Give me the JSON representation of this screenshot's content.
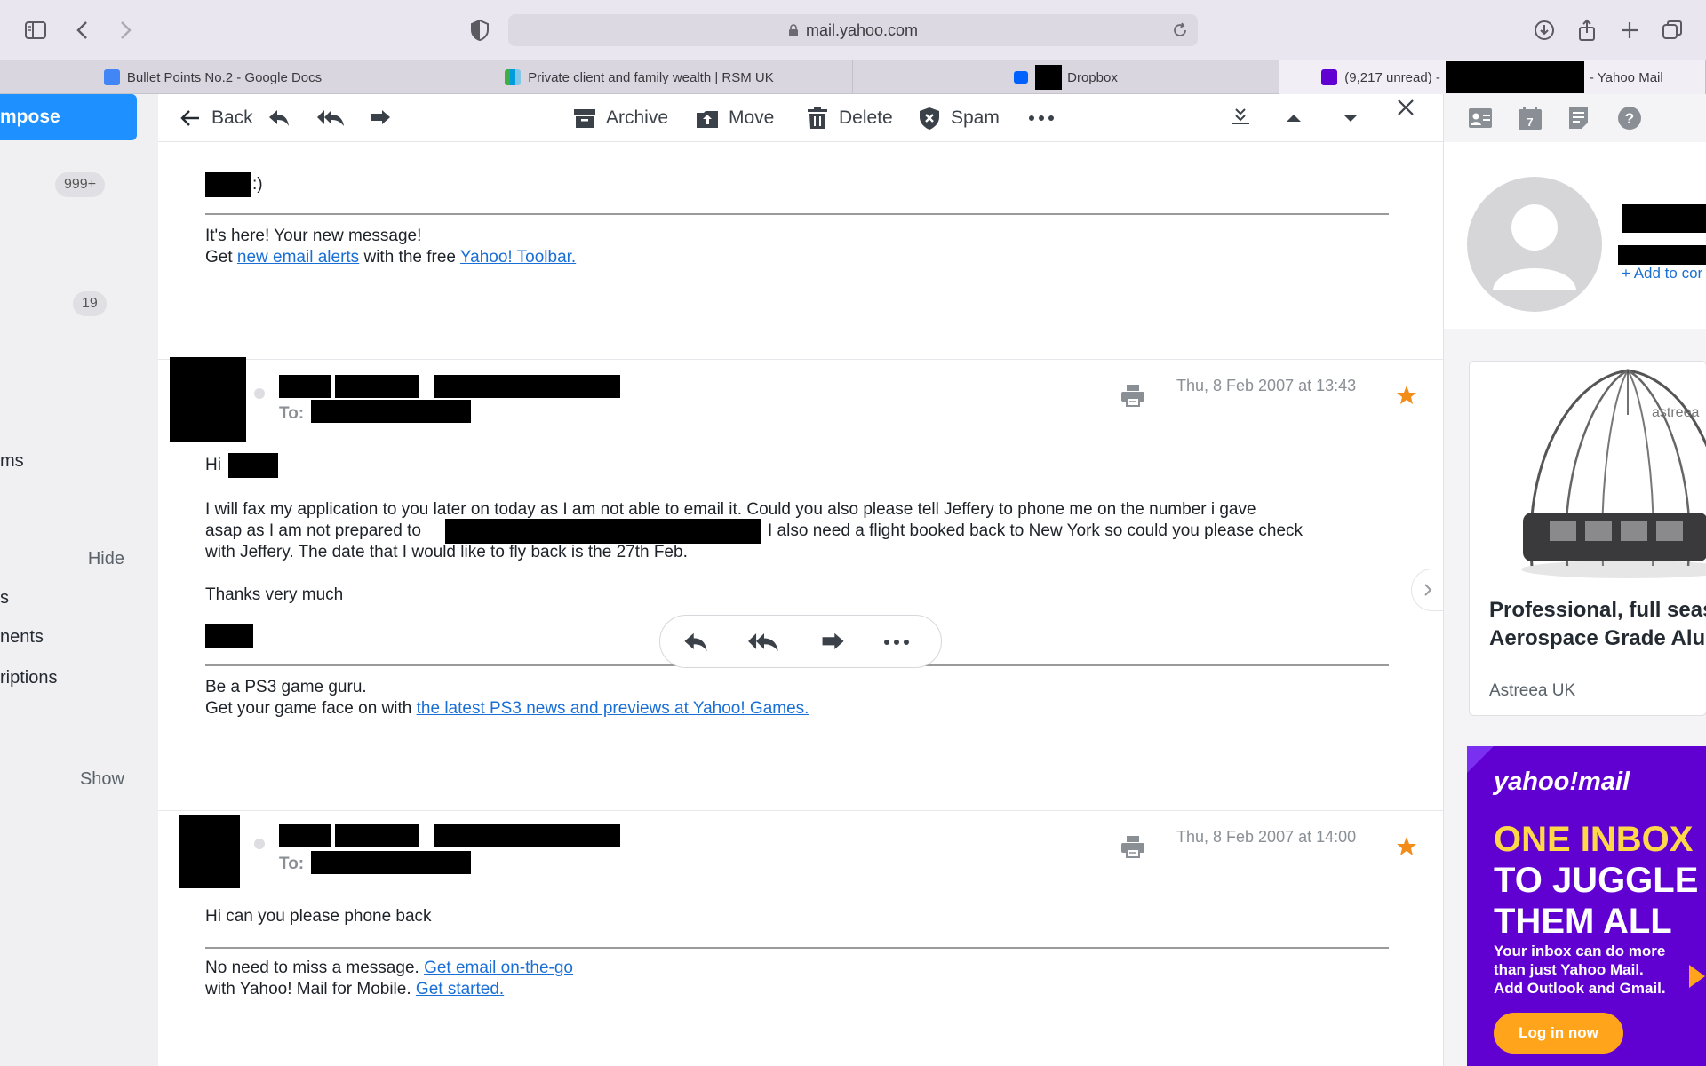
{
  "browser": {
    "url": "mail.yahoo.com",
    "tabs": [
      {
        "label": "Bullet Points No.2 - Google Docs",
        "favicon_color": "#4285f4"
      },
      {
        "label": "Private client and family wealth | RSM UK",
        "favicon_color": "#009cde"
      },
      {
        "label": "Dropbox",
        "favicon_color": "#0061fe"
      },
      {
        "label_prefix": "(9,217 unread) -",
        "label_suffix": "- Yahoo Mail",
        "favicon_color": "#6001d2"
      }
    ]
  },
  "sidebar": {
    "compose_label": "mpose",
    "badge_inbox": "999+",
    "badge_second": "19",
    "item_ms": "ms",
    "hide_label": "Hide",
    "item_s": "s",
    "item_nents": "nents",
    "item_riptions": "riptions",
    "show_label": "Show"
  },
  "message_toolbar": {
    "back": "Back",
    "archive": "Archive",
    "move": "Move",
    "delete": "Delete",
    "spam": "Spam"
  },
  "first_message": {
    "top_suffix": ":)",
    "footer_line1": "It's here! Your new message!",
    "footer_get": "Get",
    "footer_link1": "new email alerts",
    "footer_mid": "with the free",
    "footer_link2": "Yahoo! Toolbar."
  },
  "second_message": {
    "to_label": "To:",
    "date": "Thu, 8 Feb 2007 at 13:43",
    "greeting": "Hi",
    "body_line1": "I will fax my application to you later on today as I am not able to email it. Could you also please tell Jeffery to phone me on the number i gave",
    "body_line2a": "asap as I am not prepared to",
    "body_line2b": "I also need a flight booked back to New York so could you please check",
    "body_line3": "with Jeffery. The date that I would like to fly back is the 27th Feb.",
    "thanks": "Thanks very much",
    "footer_line1": "Be a PS3 game guru.",
    "footer_prefix": "Get your game face on with",
    "footer_link": "the latest PS3 news and previews at Yahoo! Games."
  },
  "third_message": {
    "to_label": "To:",
    "date": "Thu, 8 Feb 2007 at 14:00",
    "body": "Hi can you please phone back",
    "footer_line1_prefix": "No need to miss a message.",
    "footer_link1": "Get email on-the-go",
    "footer_line2_prefix": "with Yahoo! Mail for Mobile.",
    "footer_link2": "Get started."
  },
  "right_panel": {
    "add_contact": "+ Add to cor",
    "ad_brand_overlay": "astreea",
    "ad_title_line1": "Professional, full seas",
    "ad_title_line2": "Aerospace Grade Alur",
    "ad_sponsor": "Astreea UK",
    "yahoo_ad": {
      "logo": "yahoo!mail",
      "head1": "ONE INBOX",
      "head2": "TO JUGGLE",
      "head3": "THEM ALL",
      "sub1": "Your inbox can do more",
      "sub2": "than just Yahoo Mail.",
      "sub3": "Add Outlook and Gmail.",
      "button": "Log in now"
    }
  },
  "colors": {
    "accent": "#1e90ff",
    "star": "#f28c1b",
    "link": "#1a6fd6",
    "yahoo_purple": "#6001d2"
  }
}
